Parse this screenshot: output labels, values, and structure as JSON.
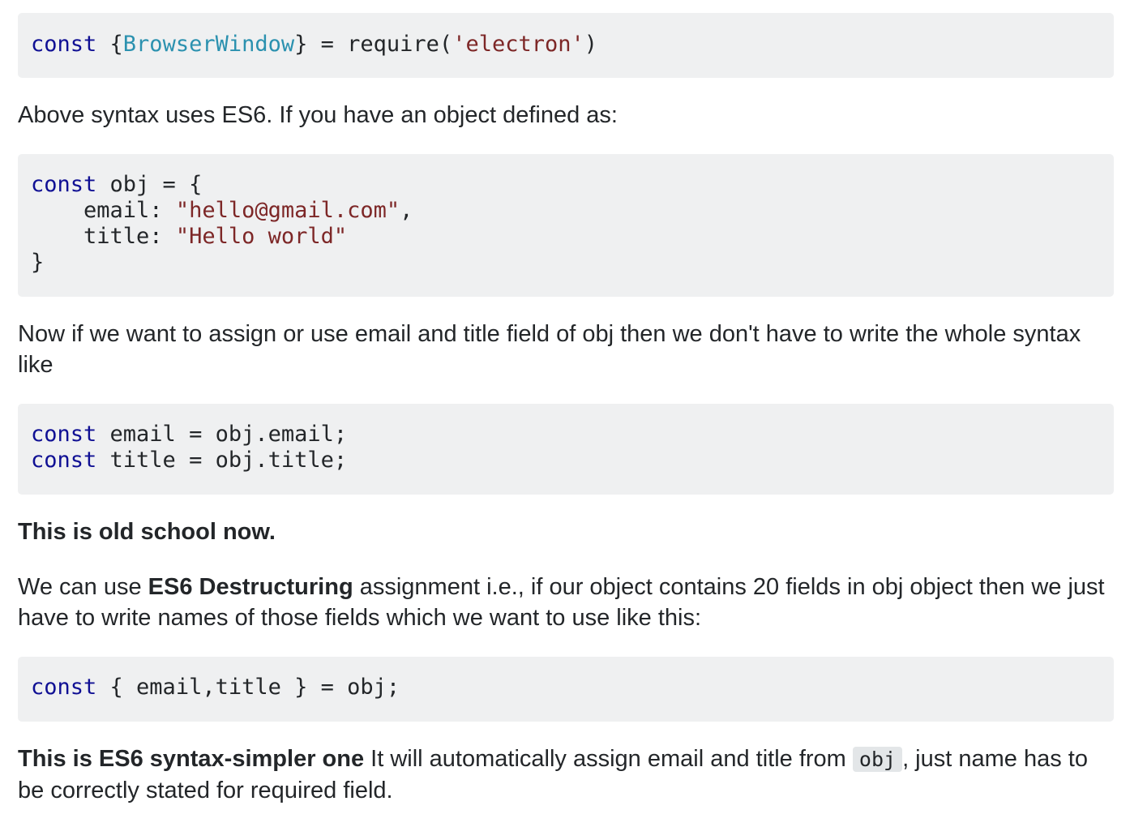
{
  "code1": {
    "kw": "const",
    "open": " {",
    "type": "BrowserWindow",
    "mid": "} = require(",
    "str": "'electron'",
    "close": ")"
  },
  "para1": "Above syntax uses ES6. If you have an object defined as:",
  "code2": {
    "line1_kw": "const",
    "line1_rest": " obj = {",
    "line2_key": "    email: ",
    "line2_str": "\"hello@gmail.com\"",
    "line2_end": ",",
    "line3_key": "    title: ",
    "line3_str": "\"Hello world\"",
    "line4": "}"
  },
  "para2": "Now if we want to assign or use email and title field of obj then we don't have to write the whole syntax like",
  "code3": {
    "line1_kw": "const",
    "line1_rest": " email = obj.email;",
    "line2_kw": "const",
    "line2_rest": " title = obj.title;"
  },
  "para3": "This is old school now.",
  "para4": {
    "pre": "We can use ",
    "bold": "ES6 Destructuring",
    "post": " assignment i.e., if our object contains 20 fields in obj object then we just have to write names of those fields which we want to use like this:"
  },
  "code4": {
    "kw": "const",
    "rest": " { email,title } = obj;"
  },
  "para5": {
    "bold": "This is ES6 syntax-simpler one",
    "pre": " It will automatically assign email and title from ",
    "code": "obj",
    "post": ", just name has to be correctly stated for required field."
  }
}
